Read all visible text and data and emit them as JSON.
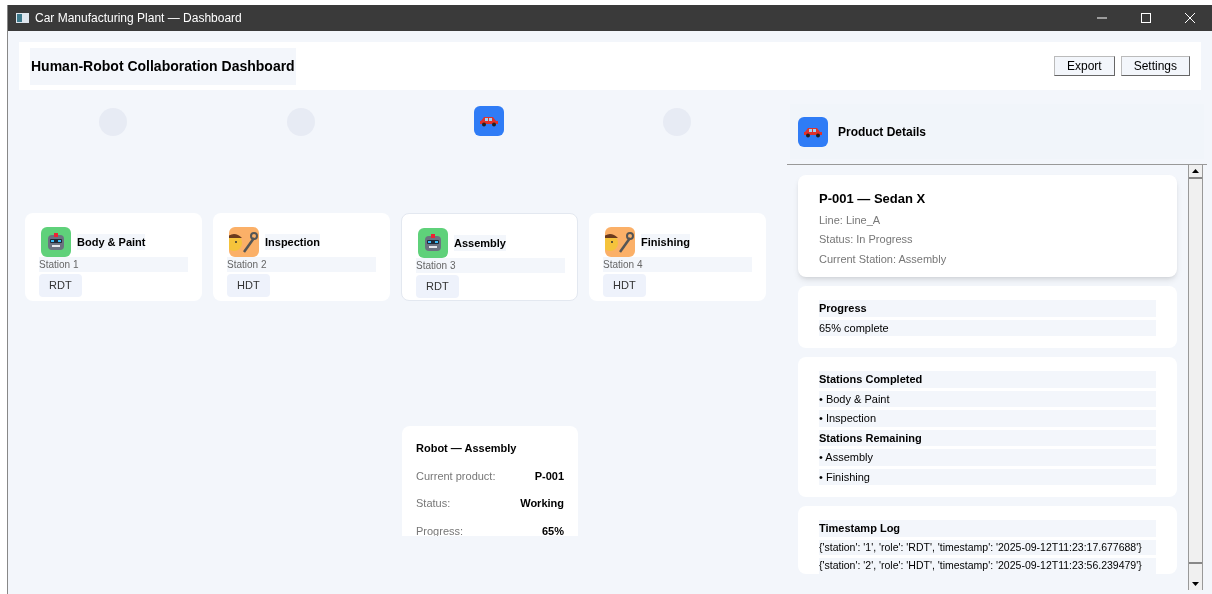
{
  "window": {
    "title": "Car Manufacturing Plant — Dashboard"
  },
  "header": {
    "title": "Human-Robot Collaboration Dashboard",
    "buttons": [
      "Export",
      "Settings"
    ]
  },
  "stations": [
    {
      "name": "Body & Paint",
      "station": "Station 1",
      "role": "RDT",
      "kind": "robot",
      "current": false
    },
    {
      "name": "Inspection",
      "station": "Station 2",
      "role": "HDT",
      "kind": "human",
      "current": false
    },
    {
      "name": "Assembly",
      "station": "Station 3",
      "role": "RDT",
      "kind": "robot",
      "current": true
    },
    {
      "name": "Finishing",
      "station": "Station 4",
      "role": "HDT",
      "kind": "human",
      "current": false
    }
  ],
  "popup": {
    "title": "Robot — Assembly",
    "rows": [
      {
        "label": "Current product:",
        "value": "P-001"
      },
      {
        "label": "Status:",
        "value": "Working"
      },
      {
        "label": "Progress:",
        "value": "65%"
      }
    ]
  },
  "product_panel": {
    "title": "Product Details",
    "summary": {
      "title": "P-001 — Sedan X",
      "lines": [
        "Line: Line_A",
        "Status: In Progress",
        "Current Station: Assembly"
      ]
    },
    "progress": {
      "title": "Progress",
      "text": "65% complete"
    },
    "completed": {
      "title": "Stations Completed",
      "items": [
        "• Body & Paint",
        "• Inspection"
      ]
    },
    "remaining": {
      "title": "Stations Remaining",
      "items": [
        "• Assembly",
        "• Finishing"
      ]
    },
    "log": {
      "title": "Timestamp Log",
      "entries": [
        "{'station': '1', 'role': 'RDT', 'timestamp': '2025-09-12T11:23:17.677688'}",
        "{'station': '2', 'role': 'HDT', 'timestamp': '2025-09-12T11:23:56.239479'}"
      ]
    }
  }
}
